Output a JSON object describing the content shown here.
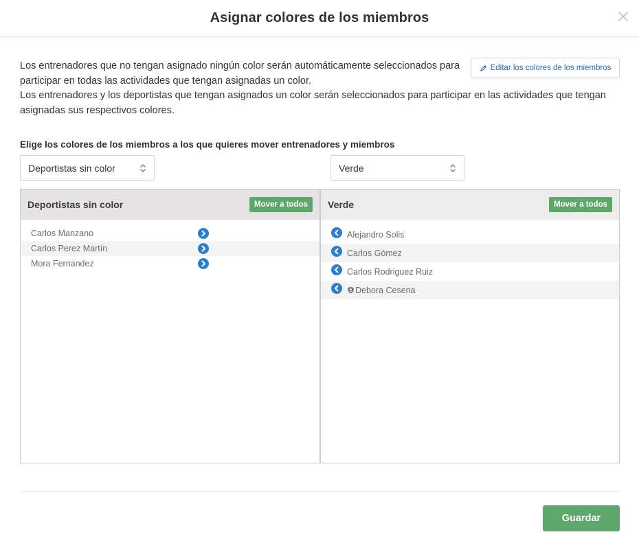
{
  "modal": {
    "title": "Asignar colores de los miembros",
    "close_icon": "close-icon"
  },
  "intro": {
    "line1": "Los entrenadores que no tengan asignado ningún color serán automáticamente seleccionados para participar en todas las actividades que tengan asignadas un color.",
    "line2": "Los entrenadores y los deportistas que tengan asignados un color serán seleccionados para participar en las actividades que tengan asignadas sus respectivos colores."
  },
  "edit_button": {
    "label": "Editar los colores de los miembros",
    "icon": "pencil-icon"
  },
  "choose_label": "Elige los colores de los miembros a los que quieres mover entrenadores y miembros",
  "selects": {
    "left": {
      "value": "Deportistas sin color"
    },
    "right": {
      "value": "Verde"
    }
  },
  "panels": {
    "left": {
      "title": "Deportistas sin color",
      "move_all_label": "Mover a todos",
      "members": [
        {
          "name": "Carlos Manzano"
        },
        {
          "name": "Carlos Perez Martín"
        },
        {
          "name": "Mora Fernandez"
        }
      ]
    },
    "right": {
      "title": "Verde",
      "move_all_label": "Mover a todos",
      "members": [
        {
          "name": "Alejandro Solis"
        },
        {
          "name": "Carlos Gómez"
        },
        {
          "name": "Carlos Rodriguez Ruiz"
        },
        {
          "name": "Debora Cesena",
          "badge_icon": "coach-shield-icon"
        }
      ]
    }
  },
  "footer": {
    "save_label": "Guardar"
  },
  "colors": {
    "accent_green": "#5ea66b",
    "arrow_blue": "#2f7fc8",
    "link_blue": "#2a6bb0"
  }
}
